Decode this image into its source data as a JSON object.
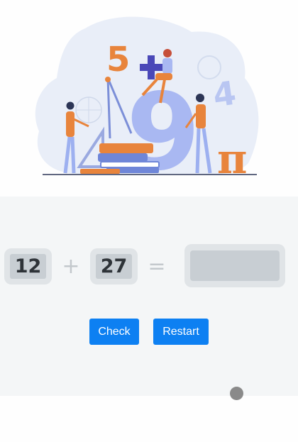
{
  "hero": {
    "illustration": "math-learning-illustration",
    "deco_digits": {
      "five": "5",
      "nine": "9",
      "four": "4",
      "pi": "π",
      "plus": "+"
    }
  },
  "problem": {
    "operand_a": "12",
    "operator": "+",
    "operand_b": "27",
    "equals": "=",
    "answer_value": "",
    "answer_placeholder": ""
  },
  "buttons": {
    "check_label": "Check",
    "restart_label": "Restart"
  },
  "colors": {
    "accent": "#0d80f2",
    "panel_bg": "#f4f6f7",
    "box_outer": "#e0e4e7",
    "box_inner": "#c8ced3",
    "orange": "#e8843c",
    "periwinkle": "#a9b8f2"
  }
}
